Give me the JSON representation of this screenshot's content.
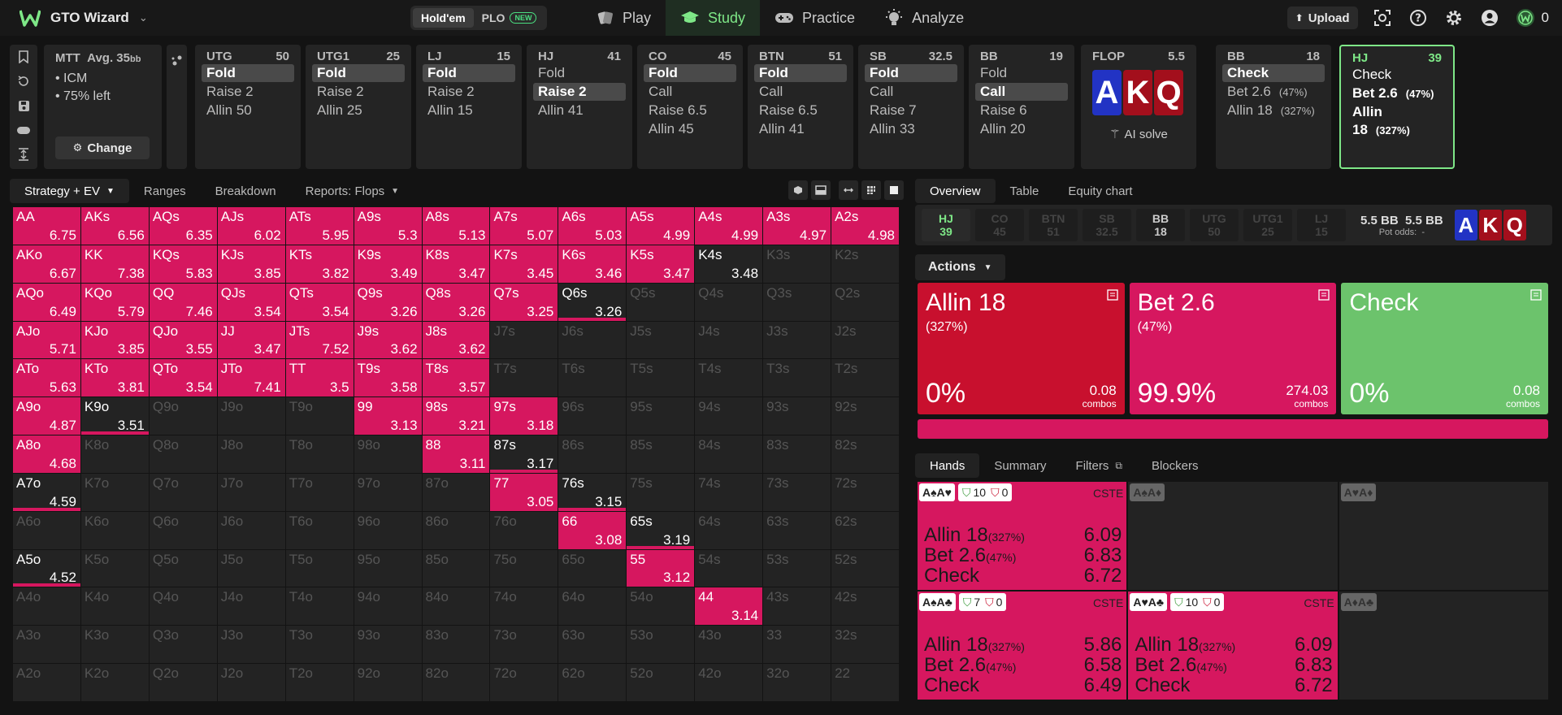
{
  "app": {
    "name": "GTO Wizard"
  },
  "game_toggle": {
    "holdem": "Hold'em",
    "plo": "PLO",
    "new_badge": "NEW"
  },
  "nav": [
    {
      "label": "Play"
    },
    {
      "label": "Study"
    },
    {
      "label": "Practice"
    },
    {
      "label": "Analyze"
    }
  ],
  "toolbar": {
    "upload": "Upload",
    "credits": "0"
  },
  "mtt": {
    "title": "MTT",
    "avg": "Avg. 35",
    "avg_unit": "bb",
    "line1": "• ICM",
    "line2": "• 75% left",
    "change": "Change"
  },
  "seats": [
    {
      "pos": "UTG",
      "stack": "50",
      "actions": [
        "Fold",
        "Raise 2",
        "Allin 50"
      ],
      "sel": 0
    },
    {
      "pos": "UTG1",
      "stack": "25",
      "actions": [
        "Fold",
        "Raise 2",
        "Allin 25"
      ],
      "sel": 0
    },
    {
      "pos": "LJ",
      "stack": "15",
      "actions": [
        "Fold",
        "Raise 2",
        "Allin 15"
      ],
      "sel": 0
    },
    {
      "pos": "HJ",
      "stack": "41",
      "actions": [
        "Fold",
        "Raise 2",
        "Allin 41"
      ],
      "sel": 1
    },
    {
      "pos": "CO",
      "stack": "45",
      "actions": [
        "Fold",
        "Call",
        "Raise 6.5",
        "Allin 45"
      ],
      "sel": 0
    },
    {
      "pos": "BTN",
      "stack": "51",
      "actions": [
        "Fold",
        "Call",
        "Raise 6.5",
        "Allin 41"
      ],
      "sel": 0
    },
    {
      "pos": "SB",
      "stack": "32.5",
      "actions": [
        "Fold",
        "Call",
        "Raise 7",
        "Allin 33"
      ],
      "sel": 0
    },
    {
      "pos": "BB",
      "stack": "19",
      "actions": [
        "Fold",
        "Call",
        "Raise 6",
        "Allin 20"
      ],
      "sel": 1
    }
  ],
  "flop": {
    "label": "FLOP",
    "pot": "5.5",
    "cards": [
      "A",
      "K",
      "Q"
    ],
    "ai_solve": "AI solve"
  },
  "bb_post": {
    "pos": "BB",
    "stack": "18",
    "a1": "Check",
    "a2": "Bet 2.6",
    "p2": "(47%)",
    "a3": "Allin 18",
    "p3": "(327%)"
  },
  "hj_post": {
    "pos": "HJ",
    "stack": "39",
    "a1": "Check",
    "a2": "Bet 2.6",
    "p2": "(47%)",
    "a3": "Allin 18",
    "p3": "(327%)"
  },
  "left_tabs": {
    "strategy": "Strategy + EV",
    "ranges": "Ranges",
    "breakdown": "Breakdown",
    "reports": "Reports: Flops"
  },
  "right_tabs": {
    "overview": "Overview",
    "table": "Table",
    "equity": "Equity chart"
  },
  "posbar": {
    "chips": [
      {
        "p": "HJ",
        "s": "39"
      },
      {
        "p": "CO",
        "s": "45"
      },
      {
        "p": "BTN",
        "s": "51"
      },
      {
        "p": "SB",
        "s": "32.5"
      },
      {
        "p": "BB",
        "s": "18"
      },
      {
        "p": "UTG",
        "s": "50"
      },
      {
        "p": "UTG1",
        "s": "25"
      },
      {
        "p": "LJ",
        "s": "15"
      }
    ],
    "pot1": "5.5 BB",
    "pot2": "5.5 BB",
    "pot_odds_label": "Pot odds:",
    "pot_odds": "-"
  },
  "actions_label": "Actions",
  "action_cards": [
    {
      "name": "Allin 18",
      "pct": "(327%)",
      "freq": "0%",
      "combos": "0.08",
      "combos_label": "combos",
      "color": "#c8102e"
    },
    {
      "name": "Bet 2.6",
      "pct": "(47%)",
      "freq": "99.9%",
      "combos": "274.03",
      "combos_label": "combos",
      "color": "#d6175f"
    },
    {
      "name": "Check",
      "pct": "",
      "freq": "0%",
      "combos": "0.08",
      "combos_label": "combos",
      "color": "#6cc36c"
    }
  ],
  "hand_tabs": {
    "hands": "Hands",
    "summary": "Summary",
    "filters": "Filters",
    "blockers": "Blockers"
  },
  "hand_cells": [
    {
      "cards": "A♠A♥",
      "on": true,
      "g": "10",
      "r": "0",
      "cste": "CSTE",
      "rows": [
        [
          "Allin 18",
          "(327%)",
          "6.09"
        ],
        [
          "Bet 2.6",
          "(47%)",
          "6.83"
        ],
        [
          "Check",
          "",
          "6.72"
        ]
      ]
    },
    {
      "cards": "A♠A♦",
      "on": false
    },
    {
      "cards": "A♥A♦",
      "on": false
    },
    {
      "cards": "A♠A♣",
      "on": true,
      "g": "7",
      "r": "0",
      "cste": "CSTE",
      "rows": [
        [
          "Allin 18",
          "(327%)",
          "5.86"
        ],
        [
          "Bet 2.6",
          "(47%)",
          "6.58"
        ],
        [
          "Check",
          "",
          "6.49"
        ]
      ]
    },
    {
      "cards": "A♥A♣",
      "on": true,
      "g": "10",
      "r": "0",
      "cste": "CSTE",
      "rows": [
        [
          "Allin 18",
          "(327%)",
          "6.09"
        ],
        [
          "Bet 2.6",
          "(47%)",
          "6.83"
        ],
        [
          "Check",
          "",
          "6.72"
        ]
      ]
    },
    {
      "cards": "A♦A♣",
      "on": false
    }
  ],
  "matrix": [
    [
      [
        "AA",
        "6.75",
        1
      ],
      [
        "AKs",
        "6.56",
        1
      ],
      [
        "AQs",
        "6.35",
        1
      ],
      [
        "AJs",
        "6.02",
        1
      ],
      [
        "ATs",
        "5.95",
        1
      ],
      [
        "A9s",
        "5.3",
        1
      ],
      [
        "A8s",
        "5.13",
        1
      ],
      [
        "A7s",
        "5.07",
        1
      ],
      [
        "A6s",
        "5.03",
        1
      ],
      [
        "A5s",
        "4.99",
        1
      ],
      [
        "A4s",
        "4.99",
        1
      ],
      [
        "A3s",
        "4.97",
        1
      ],
      [
        "A2s",
        "4.98",
        1
      ]
    ],
    [
      [
        "AKo",
        "6.67",
        1
      ],
      [
        "KK",
        "7.38",
        1
      ],
      [
        "KQs",
        "5.83",
        1
      ],
      [
        "KJs",
        "3.85",
        1
      ],
      [
        "KTs",
        "3.82",
        1
      ],
      [
        "K9s",
        "3.49",
        1
      ],
      [
        "K8s",
        "3.47",
        1
      ],
      [
        "K7s",
        "3.45",
        1
      ],
      [
        "K6s",
        "3.46",
        1
      ],
      [
        "K5s",
        "3.47",
        1
      ],
      [
        "K4s",
        "3.48",
        2
      ],
      [
        "K3s",
        "",
        0
      ],
      [
        "K2s",
        "",
        0
      ]
    ],
    [
      [
        "AQo",
        "6.49",
        1
      ],
      [
        "KQo",
        "5.79",
        1
      ],
      [
        "QQ",
        "7.46",
        1
      ],
      [
        "QJs",
        "3.54",
        1
      ],
      [
        "QTs",
        "3.54",
        1
      ],
      [
        "Q9s",
        "3.26",
        1
      ],
      [
        "Q8s",
        "3.26",
        1
      ],
      [
        "Q7s",
        "3.25",
        1
      ],
      [
        "Q6s",
        "3.26",
        3
      ],
      [
        "Q5s",
        "",
        0
      ],
      [
        "Q4s",
        "",
        0
      ],
      [
        "Q3s",
        "",
        0
      ],
      [
        "Q2s",
        "",
        0
      ]
    ],
    [
      [
        "AJo",
        "5.71",
        1
      ],
      [
        "KJo",
        "3.85",
        1
      ],
      [
        "QJo",
        "3.55",
        1
      ],
      [
        "JJ",
        "3.47",
        1
      ],
      [
        "JTs",
        "7.52",
        1
      ],
      [
        "J9s",
        "3.62",
        1
      ],
      [
        "J8s",
        "3.62",
        1
      ],
      [
        "J7s",
        "",
        0
      ],
      [
        "J6s",
        "",
        0
      ],
      [
        "J5s",
        "",
        0
      ],
      [
        "J4s",
        "",
        0
      ],
      [
        "J3s",
        "",
        0
      ],
      [
        "J2s",
        "",
        0
      ]
    ],
    [
      [
        "ATo",
        "5.63",
        1
      ],
      [
        "KTo",
        "3.81",
        1
      ],
      [
        "QTo",
        "3.54",
        1
      ],
      [
        "JTo",
        "7.41",
        1
      ],
      [
        "TT",
        "3.5",
        1
      ],
      [
        "T9s",
        "3.58",
        1
      ],
      [
        "T8s",
        "3.57",
        1
      ],
      [
        "T7s",
        "",
        0
      ],
      [
        "T6s",
        "",
        0
      ],
      [
        "T5s",
        "",
        0
      ],
      [
        "T4s",
        "",
        0
      ],
      [
        "T3s",
        "",
        0
      ],
      [
        "T2s",
        "",
        0
      ]
    ],
    [
      [
        "A9o",
        "4.87",
        1
      ],
      [
        "K9o",
        "3.51",
        3
      ],
      [
        "Q9o",
        "",
        0
      ],
      [
        "J9o",
        "",
        0
      ],
      [
        "T9o",
        "",
        0
      ],
      [
        "99",
        "3.13",
        1
      ],
      [
        "98s",
        "3.21",
        1
      ],
      [
        "97s",
        "3.18",
        1
      ],
      [
        "96s",
        "",
        0
      ],
      [
        "95s",
        "",
        0
      ],
      [
        "94s",
        "",
        0
      ],
      [
        "93s",
        "",
        0
      ],
      [
        "92s",
        "",
        0
      ]
    ],
    [
      [
        "A8o",
        "4.68",
        1
      ],
      [
        "K8o",
        "",
        0
      ],
      [
        "Q8o",
        "",
        0
      ],
      [
        "J8o",
        "",
        0
      ],
      [
        "T8o",
        "",
        0
      ],
      [
        "98o",
        "",
        0
      ],
      [
        "88",
        "3.11",
        1
      ],
      [
        "87s",
        "3.17",
        3
      ],
      [
        "86s",
        "",
        0
      ],
      [
        "85s",
        "",
        0
      ],
      [
        "84s",
        "",
        0
      ],
      [
        "83s",
        "",
        0
      ],
      [
        "82s",
        "",
        0
      ]
    ],
    [
      [
        "A7o",
        "4.59",
        3
      ],
      [
        "K7o",
        "",
        0
      ],
      [
        "Q7o",
        "",
        0
      ],
      [
        "J7o",
        "",
        0
      ],
      [
        "T7o",
        "",
        0
      ],
      [
        "97o",
        "",
        0
      ],
      [
        "87o",
        "",
        0
      ],
      [
        "77",
        "3.05",
        1
      ],
      [
        "76s",
        "3.15",
        3
      ],
      [
        "75s",
        "",
        0
      ],
      [
        "74s",
        "",
        0
      ],
      [
        "73s",
        "",
        0
      ],
      [
        "72s",
        "",
        0
      ]
    ],
    [
      [
        "A6o",
        "",
        0
      ],
      [
        "K6o",
        "",
        0
      ],
      [
        "Q6o",
        "",
        0
      ],
      [
        "J6o",
        "",
        0
      ],
      [
        "T6o",
        "",
        0
      ],
      [
        "96o",
        "",
        0
      ],
      [
        "86o",
        "",
        0
      ],
      [
        "76o",
        "",
        0
      ],
      [
        "66",
        "3.08",
        1
      ],
      [
        "65s",
        "3.19",
        3
      ],
      [
        "64s",
        "",
        0
      ],
      [
        "63s",
        "",
        0
      ],
      [
        "62s",
        "",
        0
      ]
    ],
    [
      [
        "A5o",
        "4.52",
        3
      ],
      [
        "K5o",
        "",
        0
      ],
      [
        "Q5o",
        "",
        0
      ],
      [
        "J5o",
        "",
        0
      ],
      [
        "T5o",
        "",
        0
      ],
      [
        "95o",
        "",
        0
      ],
      [
        "85o",
        "",
        0
      ],
      [
        "75o",
        "",
        0
      ],
      [
        "65o",
        "",
        0
      ],
      [
        "55",
        "3.12",
        1
      ],
      [
        "54s",
        "",
        0
      ],
      [
        "53s",
        "",
        0
      ],
      [
        "52s",
        "",
        0
      ]
    ],
    [
      [
        "A4o",
        "",
        0
      ],
      [
        "K4o",
        "",
        0
      ],
      [
        "Q4o",
        "",
        0
      ],
      [
        "J4o",
        "",
        0
      ],
      [
        "T4o",
        "",
        0
      ],
      [
        "94o",
        "",
        0
      ],
      [
        "84o",
        "",
        0
      ],
      [
        "74o",
        "",
        0
      ],
      [
        "64o",
        "",
        0
      ],
      [
        "54o",
        "",
        0
      ],
      [
        "44",
        "3.14",
        1
      ],
      [
        "43s",
        "",
        0
      ],
      [
        "42s",
        "",
        0
      ]
    ],
    [
      [
        "A3o",
        "",
        0
      ],
      [
        "K3o",
        "",
        0
      ],
      [
        "Q3o",
        "",
        0
      ],
      [
        "J3o",
        "",
        0
      ],
      [
        "T3o",
        "",
        0
      ],
      [
        "93o",
        "",
        0
      ],
      [
        "83o",
        "",
        0
      ],
      [
        "73o",
        "",
        0
      ],
      [
        "63o",
        "",
        0
      ],
      [
        "53o",
        "",
        0
      ],
      [
        "43o",
        "",
        0
      ],
      [
        "33",
        "",
        0
      ],
      [
        "32s",
        "",
        0
      ]
    ],
    [
      [
        "A2o",
        "",
        0
      ],
      [
        "K2o",
        "",
        0
      ],
      [
        "Q2o",
        "",
        0
      ],
      [
        "J2o",
        "",
        0
      ],
      [
        "T2o",
        "",
        0
      ],
      [
        "92o",
        "",
        0
      ],
      [
        "82o",
        "",
        0
      ],
      [
        "72o",
        "",
        0
      ],
      [
        "62o",
        "",
        0
      ],
      [
        "52o",
        "",
        0
      ],
      [
        "42o",
        "",
        0
      ],
      [
        "32o",
        "",
        0
      ],
      [
        "22",
        "",
        0
      ]
    ]
  ]
}
